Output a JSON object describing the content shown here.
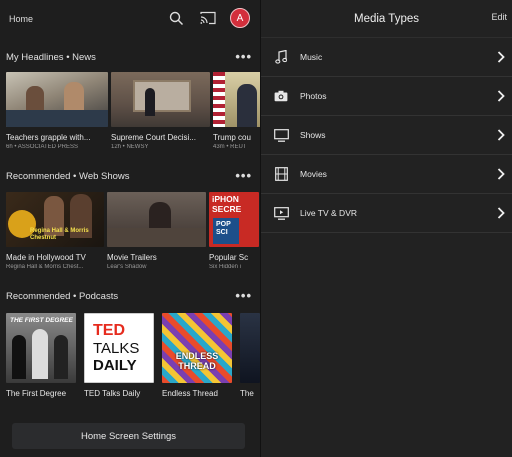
{
  "header": {
    "home_label": "Home",
    "avatar_letter": "A"
  },
  "sections": {
    "headlines": {
      "title": "My Headlines • News",
      "cards": [
        {
          "caption": "Teachers grapple with...",
          "sub": "6h • ASSOCIATED PRESS"
        },
        {
          "caption": "Supreme Court Decisi...",
          "sub": "12h • NEWSY"
        },
        {
          "caption": "Trump cou",
          "sub": "43m • REUT"
        }
      ]
    },
    "webshows": {
      "title": "Recommended • Web Shows",
      "cards": [
        {
          "caption": "Made in Hollywood TV",
          "sub": "Regina Hall & Morris Chest...",
          "art_text": "Regina Hall & Morris Chestnut"
        },
        {
          "caption": "Movie Trailers",
          "sub": "Lear's Shadow",
          "art_text": ""
        },
        {
          "caption": "Popular Sc",
          "sub": "Six Hidden i",
          "art_text": "iPHON SECRE",
          "art_text2": "POP SCI"
        }
      ]
    },
    "podcasts": {
      "title": "Recommended • Podcasts",
      "cards": [
        {
          "caption": "The First Degree",
          "art_text": "THE FIRST DEGREE"
        },
        {
          "caption": "TED Talks Daily",
          "art_text": "TED",
          "art_text2": "TALKS",
          "art_text3": "DAILY"
        },
        {
          "caption": "Endless Thread",
          "art_text": "ENDLESS THREAD"
        },
        {
          "caption": "The"
        }
      ]
    }
  },
  "settings_button": "Home Screen Settings",
  "media": {
    "title": "Media Types",
    "edit_label": "Edit",
    "items": [
      {
        "label": "Music",
        "icon": "music-note-icon"
      },
      {
        "label": "Photos",
        "icon": "camera-icon"
      },
      {
        "label": "Shows",
        "icon": "monitor-icon"
      },
      {
        "label": "Movies",
        "icon": "film-icon"
      },
      {
        "label": "Live TV & DVR",
        "icon": "live-tv-icon"
      }
    ]
  },
  "colors": {
    "avatar": "#d32f3c",
    "background": "#1e1e1e",
    "panel": "#222222"
  }
}
